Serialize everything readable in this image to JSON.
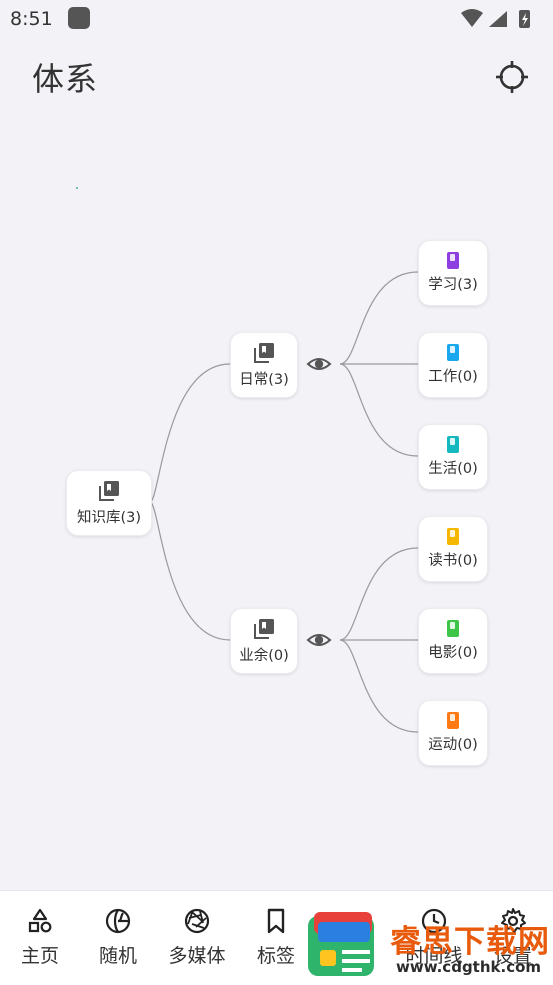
{
  "status_bar": {
    "time": "8:51"
  },
  "header": {
    "title": "体系"
  },
  "mindmap": {
    "root": {
      "label": "知识库(3)"
    },
    "groups": [
      {
        "label": "日常(3)",
        "children": [
          {
            "label": "学习(3)",
            "color": "#8e3ee0"
          },
          {
            "label": "工作(0)",
            "color": "#19a7f0"
          },
          {
            "label": "生活(0)",
            "color": "#14b8be"
          }
        ]
      },
      {
        "label": "业余(0)",
        "children": [
          {
            "label": "读书(0)",
            "color": "#f6b700"
          },
          {
            "label": "电影(0)",
            "color": "#3dc54a"
          },
          {
            "label": "运动(0)",
            "color": "#ff7a12"
          }
        ]
      }
    ]
  },
  "bottom_nav": {
    "items": [
      {
        "label": "主页"
      },
      {
        "label": "随机"
      },
      {
        "label": "多媒体"
      },
      {
        "label": "标签"
      },
      {
        "label": "时间线"
      },
      {
        "label": "设置"
      }
    ]
  },
  "watermark": {
    "title": "睿思下载网",
    "url": "www.cdgthk.com"
  }
}
